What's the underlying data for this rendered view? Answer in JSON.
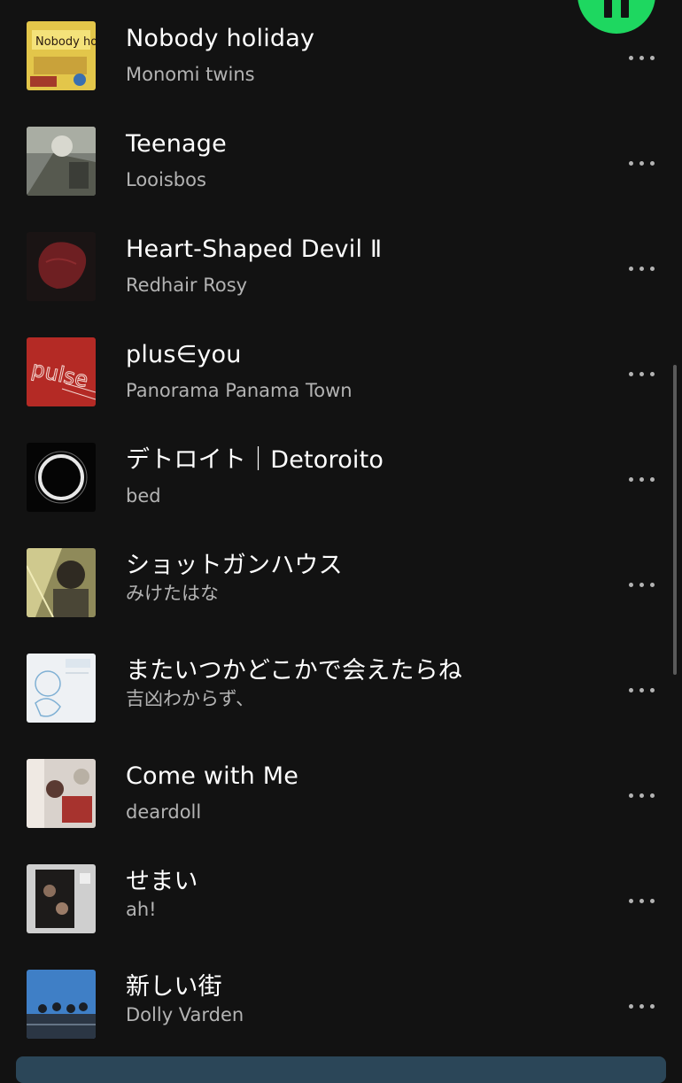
{
  "player": {
    "state_icon": "pause-icon",
    "accent_color": "#1ed760"
  },
  "more_icon": "more-options-icon",
  "tracks": [
    {
      "title": "Nobody holiday",
      "artist": "Monomi twins",
      "art_text": "Nobody holiday"
    },
    {
      "title": "Teenage",
      "artist": "Looisbos"
    },
    {
      "title": "Heart-Shaped Devil Ⅱ",
      "artist": "Redhair Rosy"
    },
    {
      "title": "plus∈you",
      "artist": "Panorama Panama Town",
      "art_text": "pulse"
    },
    {
      "title": "デトロイト｜Detoroito",
      "artist": "bed"
    },
    {
      "title": "ショットガンハウス",
      "artist": "みけたはな"
    },
    {
      "title": "またいつかどこかで会えたらね",
      "artist": "吉凶わからず、"
    },
    {
      "title": "Come with Me",
      "artist": "deardoll"
    },
    {
      "title": "せまい",
      "artist": "ah!"
    },
    {
      "title": "新しい街",
      "artist": "Dolly Varden"
    }
  ]
}
